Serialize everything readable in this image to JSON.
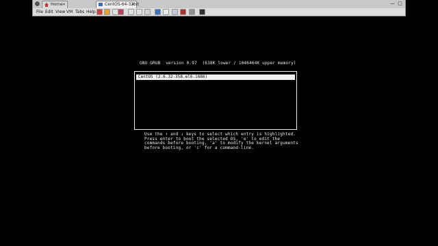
{
  "tabs": [
    {
      "label": "Home",
      "close": "×"
    },
    {
      "label": "CentOS-64-32bit",
      "close": "×"
    }
  ],
  "window_controls": {
    "minimize": "—",
    "maximize": "▢",
    "close": "×"
  },
  "menu": [
    "File",
    "Edit",
    "View",
    "VM",
    "Tabs",
    "Help"
  ],
  "grub": {
    "header": "GNU GRUB  version 0.97  (638K lower / 1046464K upper memory)",
    "entries": [
      "CentOS (2.6.32-358.el6.i686)"
    ],
    "selected_index": 0,
    "help_lines": [
      "Use the ↑ and ↓ keys to select which entry is highlighted.",
      "Press enter to boot the selected OS, 'e' to edit the",
      "commands before booting, 'a' to modify the kernel arguments",
      "before booting, or 'c' for a command-line."
    ]
  },
  "colors": {
    "screen_bg": "#000000",
    "screen_fg": "#f0f0f0",
    "chrome_bg": "#dcdcdc"
  }
}
